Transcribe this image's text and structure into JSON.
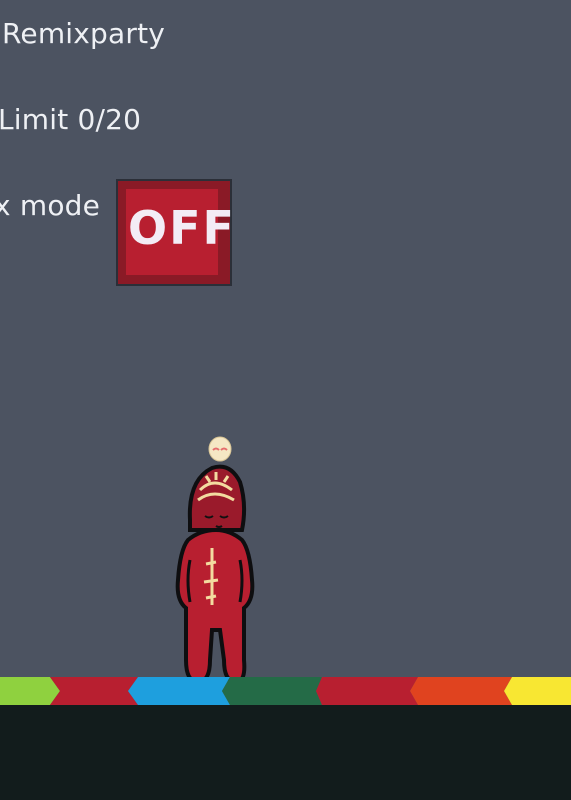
{
  "hud": {
    "title": "Remixparty",
    "limit": "Limit 0/20",
    "mode_label": "x mode"
  },
  "toggle": {
    "state": "OFF"
  },
  "colors": {
    "background": "#4c5361",
    "floor": "#121c1c",
    "toggle_off": "#b81f30",
    "character_body": "#b81f30",
    "floor_segments": [
      "#8fd13f",
      "#b81f30",
      "#1e9fde",
      "#246b47",
      "#b81f30",
      "#e0431f",
      "#f8e732"
    ]
  },
  "icons": {
    "character": "red-hooded-figure",
    "floating_item": "egg-icon"
  }
}
